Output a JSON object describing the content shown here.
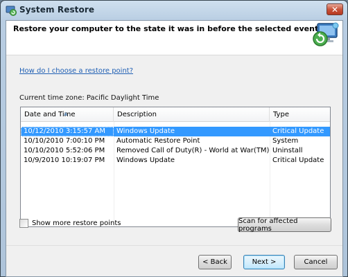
{
  "window": {
    "title": "System Restore"
  },
  "header": {
    "text": "Restore your computer to the state it was in before the selected event"
  },
  "help_link": "How do I choose a restore point?",
  "timezone_label": "Current time zone: Pacific Daylight Time",
  "table": {
    "columns": [
      "Date and Time",
      "Description",
      "Type"
    ],
    "sorted_column": "Date and Time",
    "rows": [
      {
        "date": "10/12/2010 3:15:57 AM",
        "description": "Windows Update",
        "type": "Critical Update",
        "selected": true
      },
      {
        "date": "10/10/2010 7:00:10 PM",
        "description": "Automatic Restore Point",
        "type": "System",
        "selected": false
      },
      {
        "date": "10/10/2010 5:52:06 PM",
        "description": "Removed Call of Duty(R) - World at War(TM)",
        "type": "Uninstall",
        "selected": false
      },
      {
        "date": "10/9/2010 10:19:07 PM",
        "description": "Windows Update",
        "type": "Critical Update",
        "selected": false
      }
    ]
  },
  "show_more_label": "Show more restore points",
  "show_more_checked": false,
  "buttons": {
    "scan": "Scan for affected programs",
    "back": "< Back",
    "next": "Next >",
    "cancel": "Cancel"
  },
  "colors": {
    "selection": "#3399ff",
    "link": "#1f5fb4"
  }
}
